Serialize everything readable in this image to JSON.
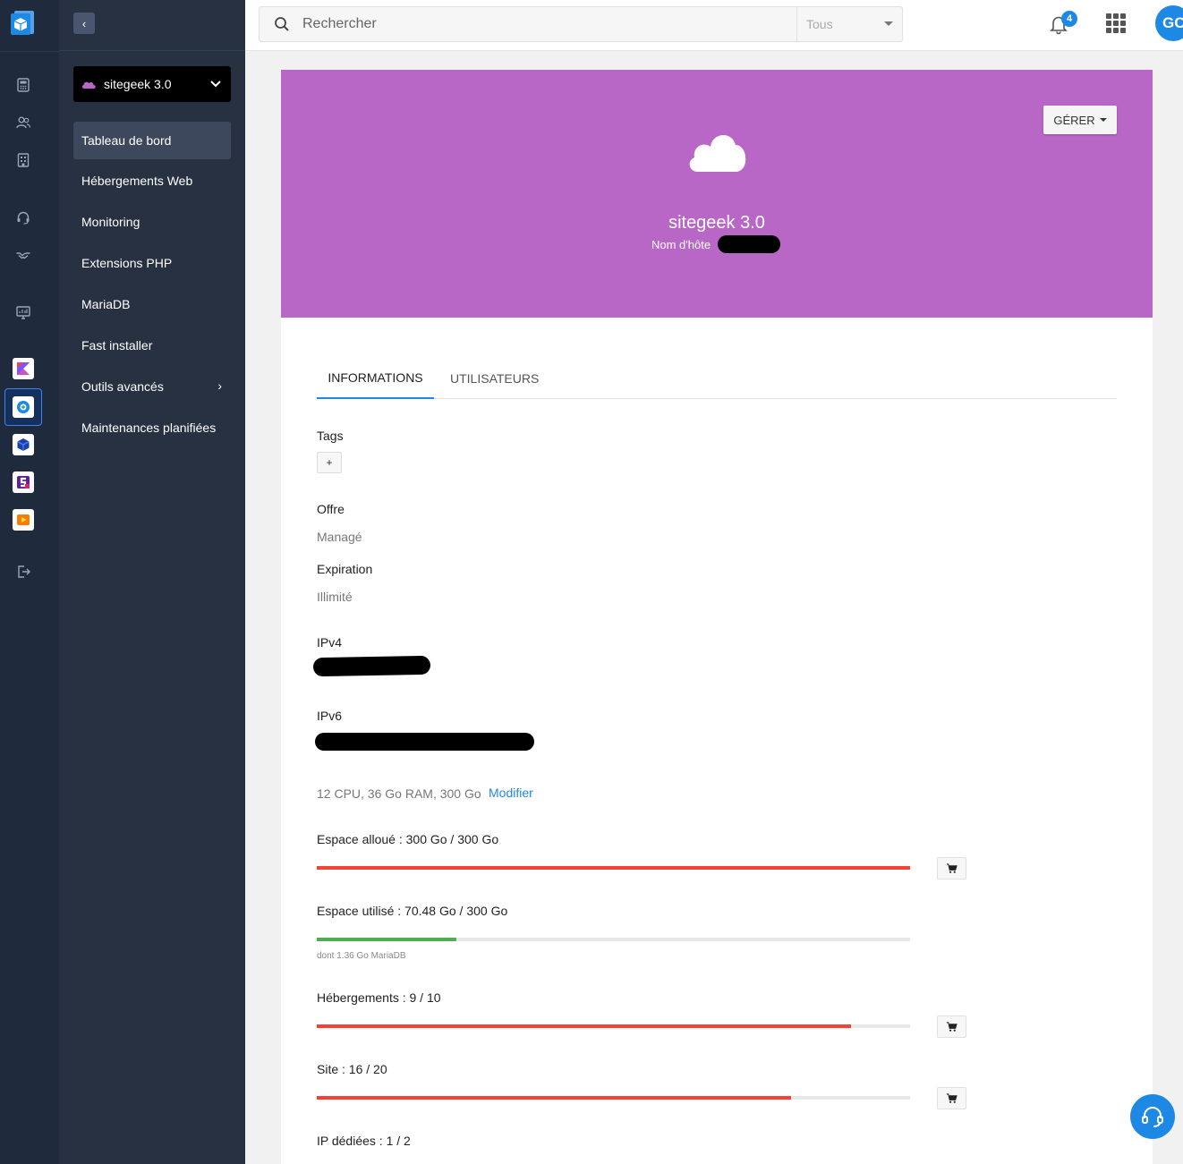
{
  "nav": {
    "site_name": "sitegeek 3.0",
    "items": [
      {
        "label": "Tableau de bord"
      },
      {
        "label": "Hébergements Web"
      },
      {
        "label": "Monitoring"
      },
      {
        "label": "Extensions PHP"
      },
      {
        "label": "MariaDB"
      },
      {
        "label": "Fast installer"
      },
      {
        "label": "Outils avancés"
      },
      {
        "label": "Maintenances planifiées"
      }
    ]
  },
  "topbar": {
    "search_placeholder": "Rechercher",
    "search_scope": "Tous",
    "notification_count": "4",
    "avatar_initials": "GC"
  },
  "hero": {
    "manage_label": "GÉRER",
    "title": "sitegeek 3.0",
    "hostname_label": "Nom d'hôte"
  },
  "tabs": [
    {
      "label": "INFORMATIONS"
    },
    {
      "label": "UTILISATEURS"
    }
  ],
  "info": {
    "tags_label": "Tags",
    "tag_add": "+",
    "offer_label": "Offre",
    "offer_value": "Managé",
    "expiration_label": "Expiration",
    "expiration_value": "Illimité",
    "ipv4_label": "IPv4",
    "ipv6_label": "IPv6",
    "resources": "12 CPU, 36 Go RAM, 300 Go",
    "modify_label": "Modifier"
  },
  "quotas": [
    {
      "label": "Espace alloué : 300 Go / 300 Go",
      "fraction": 1.0,
      "color": "#f44336"
    },
    {
      "label": "Espace utilisé : 70.48 Go / 300 Go",
      "fraction": 0.235,
      "color": "#4caf50",
      "note": "dont 1.36 Go MariaDB"
    },
    {
      "label": "Hébergements : 9 / 10",
      "fraction": 0.9,
      "color": "#f44336"
    },
    {
      "label": "Site : 16 / 20",
      "fraction": 0.8,
      "color": "#f44336"
    },
    {
      "label": "IP dédiées : 1 / 2"
    }
  ],
  "colors": {
    "hero": "#b967c7",
    "accent": "#1e88e5",
    "sidebar": "#273142",
    "rail": "#1f2a3c"
  }
}
